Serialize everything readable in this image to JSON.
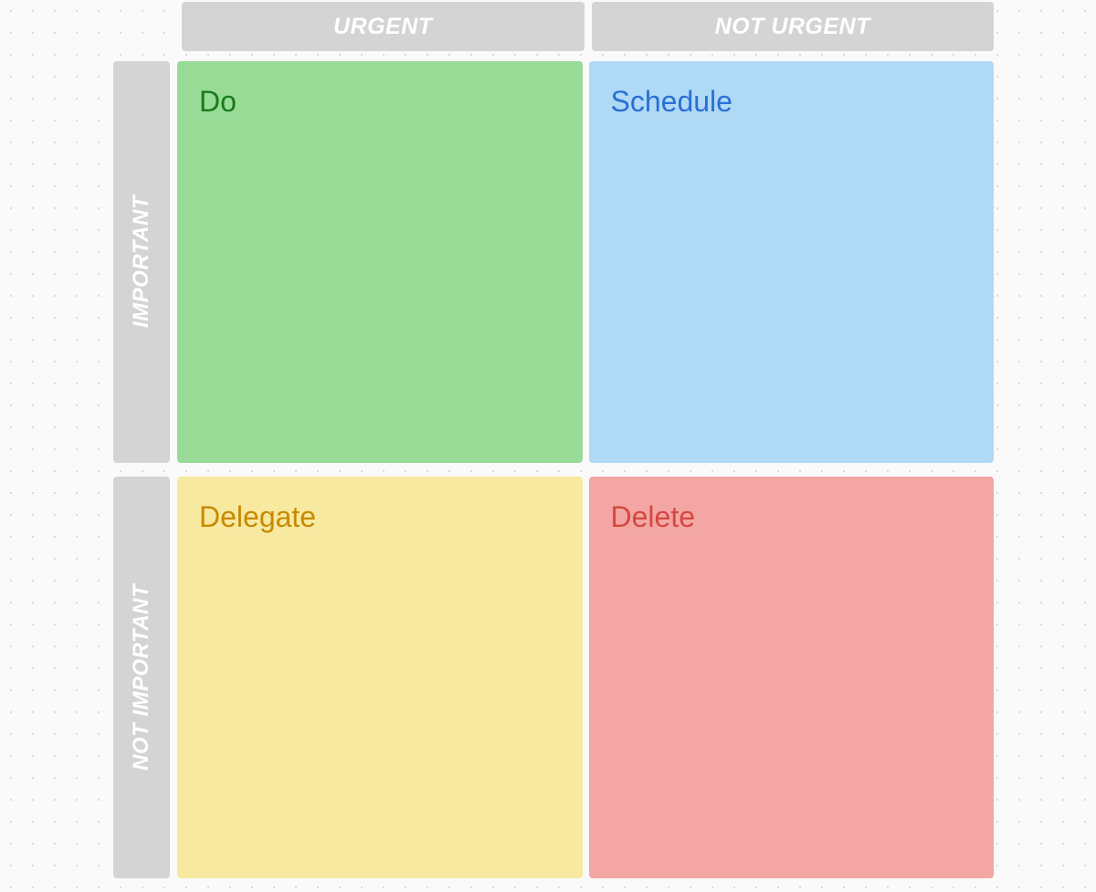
{
  "columns": {
    "urgent": "URGENT",
    "not_urgent": "NOT URGENT"
  },
  "rows": {
    "important": "IMPORTANT",
    "not_important": "NOT IMPORTANT"
  },
  "quadrants": {
    "do": "Do",
    "schedule": "Schedule",
    "delegate": "Delegate",
    "delete": "Delete"
  },
  "colors": {
    "do_bg": "#97db97",
    "do_text": "#1a7a1a",
    "schedule_bg": "#b0d9f5",
    "schedule_text": "#2a6fd6",
    "delegate_bg": "#f8e9a0",
    "delegate_text": "#c78a00",
    "delete_bg": "#f3a6a3",
    "delete_text": "#d64842",
    "header_bg": "#d4d4d4",
    "header_text": "#ffffff"
  }
}
